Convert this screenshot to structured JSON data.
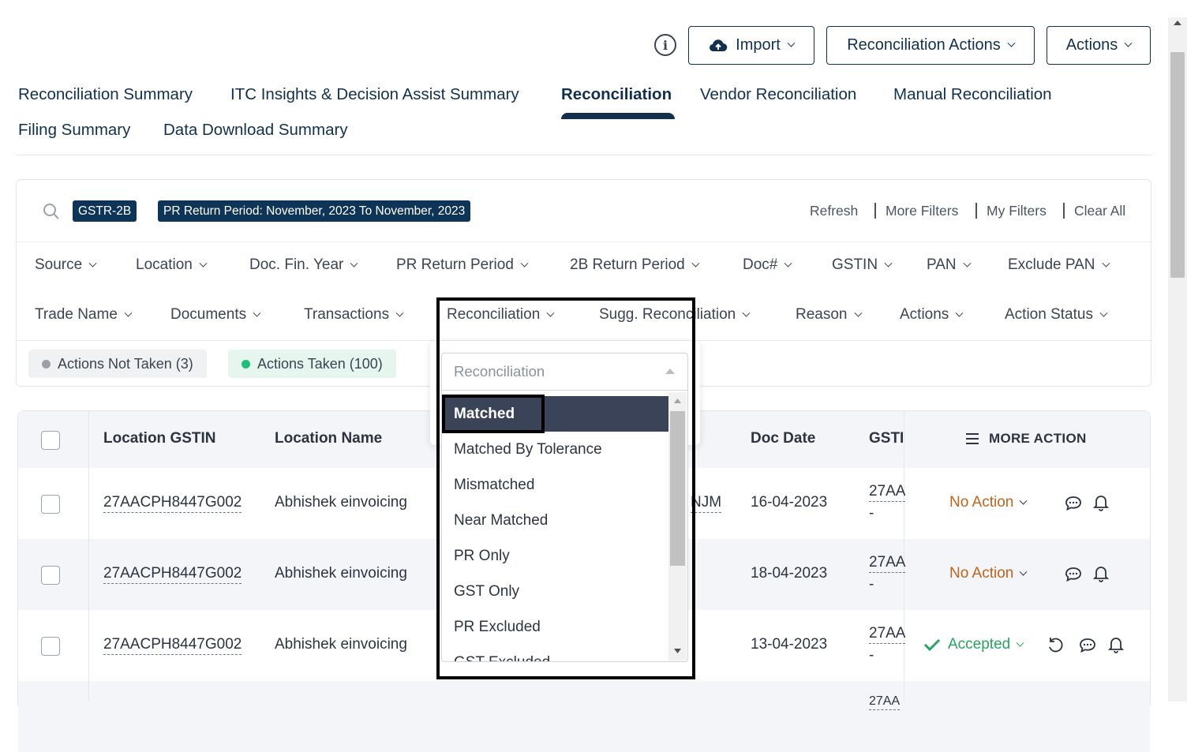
{
  "header": {
    "info_icon": "info-circle-icon",
    "import_label": "Import",
    "reconciliation_actions_label": "Reconciliation Actions",
    "actions_label": "Actions"
  },
  "tabs": [
    {
      "label": "Reconciliation Summary"
    },
    {
      "label": "ITC Insights & Decision Assist Summary"
    },
    {
      "label": "Reconciliation",
      "active": true
    },
    {
      "label": "Vendor Reconciliation"
    },
    {
      "label": "Manual Reconciliation"
    },
    {
      "label": "Filing Summary"
    },
    {
      "label": "Data Download Summary"
    }
  ],
  "filter_bar": {
    "chips": [
      "GSTR-2B",
      "PR Return Period: November, 2023 To November, 2023"
    ],
    "links": [
      "Refresh",
      "More Filters",
      "My Filters",
      "Clear All"
    ]
  },
  "filters_row1": [
    "Source",
    "Location",
    "Doc. Fin. Year",
    "PR Return Period",
    "2B Return Period",
    "Doc#",
    "GSTIN",
    "PAN",
    "Exclude PAN"
  ],
  "filters_row2": [
    "Trade Name",
    "Documents",
    "Transactions",
    "Reconciliation",
    "Sugg. Reconciliation",
    "Reason",
    "Actions",
    "Action Status"
  ],
  "status_pills": [
    {
      "label": "Actions Not Taken (3)",
      "color": "#9aa0a6"
    },
    {
      "label": "Actions Taken (100)",
      "color": "#1fbf7a"
    }
  ],
  "table": {
    "headers": {
      "location_gstin": "Location GSTIN",
      "location_name": "Location Name",
      "doc_date": "Doc Date",
      "gstin": "GSTI",
      "more_action": "MORE ACTION"
    },
    "rows": [
      {
        "location_gstin": "27AACPH8447G002",
        "location_name": "Abhishek einvoicing",
        "doc_no_fragment": "NJM",
        "doc_date": "16-04-2023",
        "gstin": "27AA",
        "gstin_sub": "-",
        "action": "No Action"
      },
      {
        "location_gstin": "27AACPH8447G002",
        "location_name": "Abhishek einvoicing",
        "doc_no_fragment": "",
        "doc_date": "18-04-2023",
        "gstin": "27AA",
        "gstin_sub": "-",
        "action": "No Action"
      },
      {
        "location_gstin": "27AACPH8447G002",
        "location_name": "Abhishek einvoicing",
        "doc_no_fragment": "",
        "doc_date": "13-04-2023",
        "gstin": "27AA",
        "gstin_sub": "-",
        "action": "Accepted"
      },
      {
        "gstin": "27AA"
      }
    ]
  },
  "dropdown": {
    "placeholder": "Reconciliation",
    "options": [
      "Matched",
      "Matched By Tolerance",
      "Mismatched",
      "Near Matched",
      "PR Only",
      "GST Only",
      "PR Excluded",
      "GST Excluded"
    ],
    "selected": "Matched"
  },
  "colors": {
    "primary": "#12304d",
    "chip_bg": "#0e3457",
    "no_action": "#c0621a",
    "accepted": "#2aa260",
    "selected_option": "#3a4357"
  }
}
